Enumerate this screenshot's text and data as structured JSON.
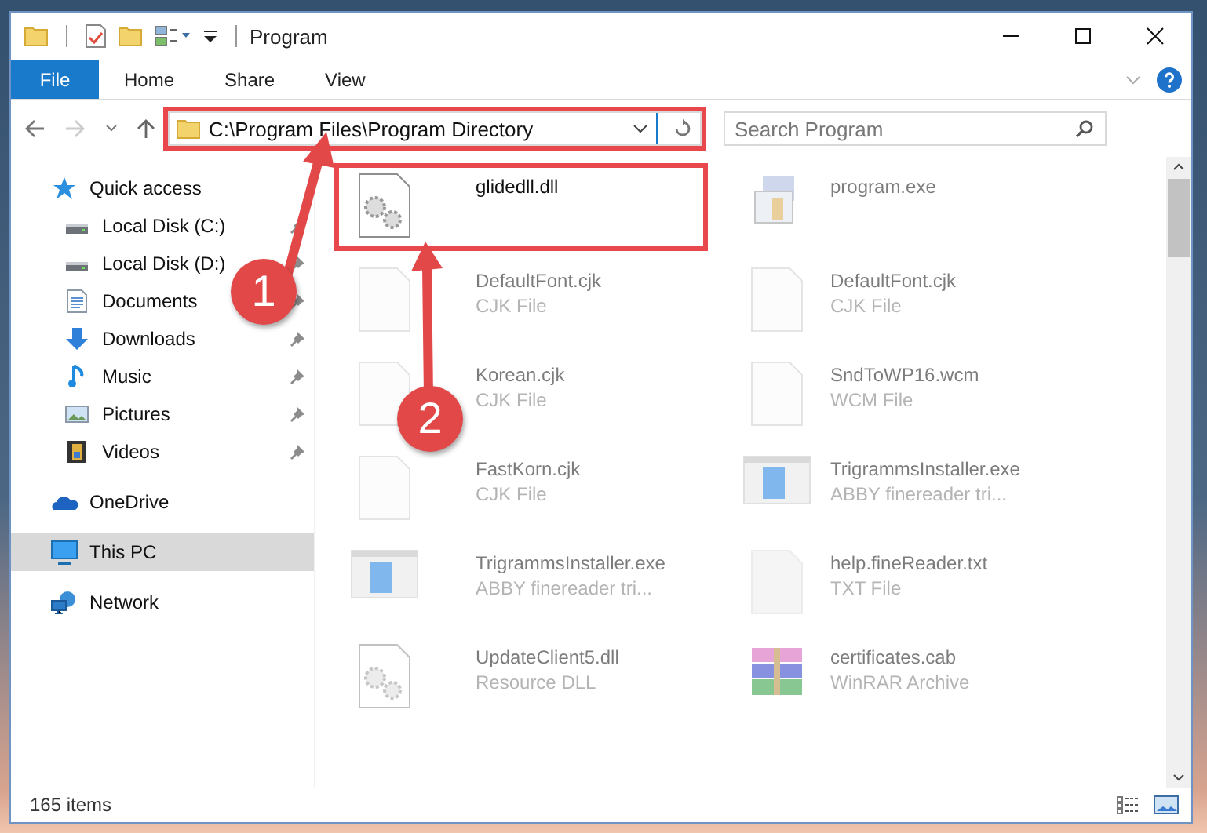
{
  "window": {
    "title": "Program"
  },
  "ribbon": {
    "tabs": [
      {
        "label": "File",
        "kind": "file_menu",
        "selected": false
      },
      {
        "label": "Home",
        "kind": "tab",
        "selected": false
      },
      {
        "label": "Share",
        "kind": "tab",
        "selected": false
      },
      {
        "label": "View",
        "kind": "tab",
        "selected": false
      }
    ]
  },
  "address_bar": {
    "path": "C:\\Program Files\\Program Directory",
    "highlighted": true
  },
  "search": {
    "placeholder": "Search Program"
  },
  "sidebar": {
    "items": [
      {
        "label": "Quick access",
        "kind": "star",
        "selected": false,
        "children": [
          {
            "label": "Local Disk (C:)",
            "kind": "drive",
            "pinned": true,
            "selected": false
          },
          {
            "label": "Local Disk (D:)",
            "kind": "drive",
            "pinned": true,
            "selected": false
          },
          {
            "label": "Documents",
            "kind": "documents",
            "pinned": true,
            "selected": false
          },
          {
            "label": "Downloads",
            "kind": "downloads",
            "pinned": true,
            "selected": false
          },
          {
            "label": "Music",
            "kind": "music",
            "pinned": true,
            "selected": false
          },
          {
            "label": "Pictures",
            "kind": "pictures",
            "pinned": true,
            "selected": false
          },
          {
            "label": "Videos",
            "kind": "videos",
            "pinned": true,
            "selected": false
          }
        ]
      },
      {
        "label": "OneDrive",
        "kind": "cloud",
        "selected": false
      },
      {
        "label": "This PC",
        "kind": "pc",
        "selected": true
      },
      {
        "label": "Network",
        "kind": "network",
        "selected": false
      }
    ]
  },
  "files": [
    {
      "name": "glidedll.dll",
      "kind": "dll",
      "highlighted": true,
      "dimmed": false
    },
    {
      "name": "program.exe",
      "kind": "exe",
      "highlighted": false,
      "dimmed": true
    },
    {
      "name": "DefaultFont.cjk",
      "type": "CJK File",
      "kind": "blank",
      "highlighted": false,
      "dimmed": true
    },
    {
      "name": "DefaultFont.cjk",
      "type": "CJK File",
      "kind": "blank",
      "highlighted": false,
      "dimmed": true
    },
    {
      "name": "Korean.cjk",
      "type": "CJK File",
      "kind": "blank",
      "highlighted": false,
      "dimmed": true
    },
    {
      "name": "SndToWP16.wcm",
      "type": "WCM File",
      "kind": "blank",
      "highlighted": false,
      "dimmed": true
    },
    {
      "name": "FastKorn.cjk",
      "type": "CJK File",
      "kind": "blank",
      "highlighted": false,
      "dimmed": true
    },
    {
      "name": "TrigrammsInstaller.exe",
      "type": "ABBY finereader tri...",
      "kind": "installer",
      "highlighted": false,
      "dimmed": true
    },
    {
      "name": "TrigrammsInstaller.exe",
      "type": "ABBY finereader tri...",
      "kind": "installer",
      "highlighted": false,
      "dimmed": true
    },
    {
      "name": "help.fineReader.txt",
      "type": "TXT File",
      "kind": "text",
      "highlighted": false,
      "dimmed": true
    },
    {
      "name": "UpdateClient5.dll",
      "type": "Resource DLL",
      "kind": "dll",
      "highlighted": false,
      "dimmed": true
    },
    {
      "name": "certificates.cab",
      "type": "WinRAR Archive",
      "kind": "archive",
      "highlighted": false,
      "dimmed": true
    }
  ],
  "callouts": [
    {
      "label": "1"
    },
    {
      "label": "2"
    }
  ],
  "status_bar": {
    "item_count": "165 items"
  }
}
